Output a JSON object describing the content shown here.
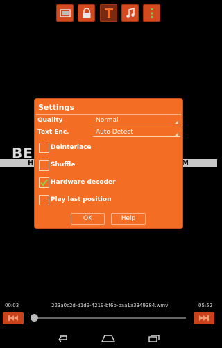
{
  "toolbar": {
    "icons": [
      "screen-icon",
      "lock-icon",
      "text-icon",
      "music-icon",
      "more-vertical-icon"
    ],
    "accent": "#d24a1e"
  },
  "watermark": {
    "large_text": "BE",
    "band_left_text": "H",
    "band_right_text": "M"
  },
  "dialog": {
    "title": "Settings",
    "accent": "#f36e24",
    "quality": {
      "label": "Quality",
      "value": "Normal"
    },
    "text_enc": {
      "label": "Text Enc.",
      "value": "Auto Detect"
    },
    "options": [
      {
        "label": "Deinterlace",
        "checked": false
      },
      {
        "label": "Shuffle",
        "checked": false
      },
      {
        "label": "Hardware decoder",
        "checked": true
      },
      {
        "label": "Play last position",
        "checked": false
      }
    ],
    "ok_label": "OK",
    "help_label": "Help"
  },
  "player": {
    "elapsed": "00:03",
    "duration": "05:52",
    "filename": "223a0c2d-d1d9-4219-bf6b-baa1a3349384.wmv",
    "progress_fraction": 0.01
  },
  "navbar": {
    "icons": [
      "back-icon",
      "home-icon",
      "recents-icon"
    ]
  }
}
